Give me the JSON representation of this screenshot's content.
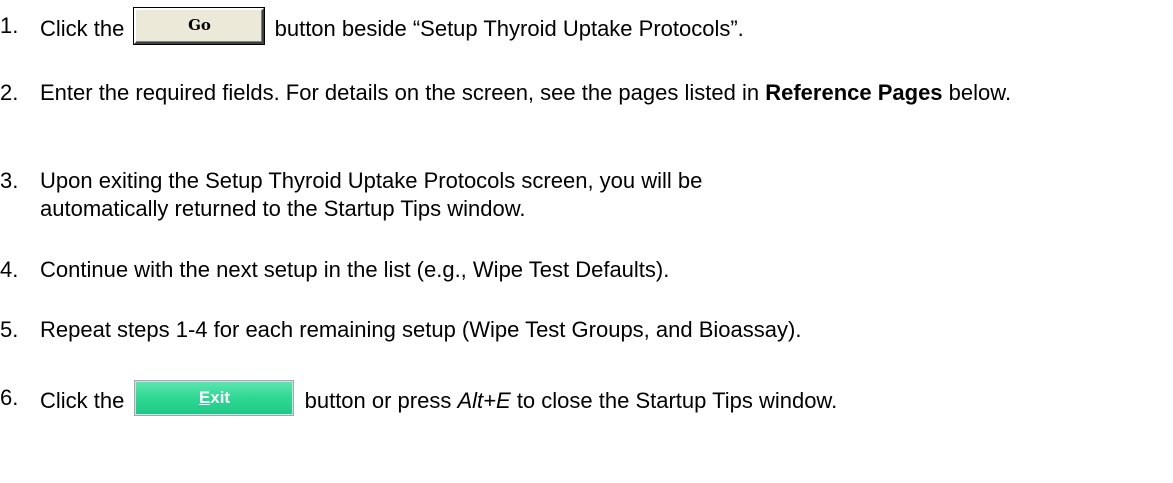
{
  "steps": [
    {
      "number": "1.",
      "before": "Click the",
      "button_label": "Go",
      "after": "button beside “Setup Thyroid Uptake Protocols”."
    },
    {
      "number": "2.",
      "text": "Enter the required fields. For details on the screen, see the pages listed in",
      "bold_text": "Reference Pages",
      "after": "below."
    },
    {
      "number": "3.",
      "text": "Upon exiting the Setup Thyroid Uptake Protocols screen, you will be automatically returned to the Startup Tips window."
    },
    {
      "number": "4.",
      "text": "Continue with the next setup in the list (e.g., Wipe Test Defaults)."
    },
    {
      "number": "5.",
      "text": "Repeat steps 1-4 for each remaining setup (Wipe Test Groups, and Bioassay)."
    },
    {
      "number": "6.",
      "before": "Click the",
      "button_label_first": "E",
      "button_label_rest": "xit",
      "middle": "button or press",
      "shortcut": "Alt+E",
      "after": "to close the Startup Tips window."
    }
  ],
  "colors": {
    "go_button_face": "#ece9d8",
    "exit_button_face": "#2ed893",
    "exit_button_text": "#ffffff"
  }
}
